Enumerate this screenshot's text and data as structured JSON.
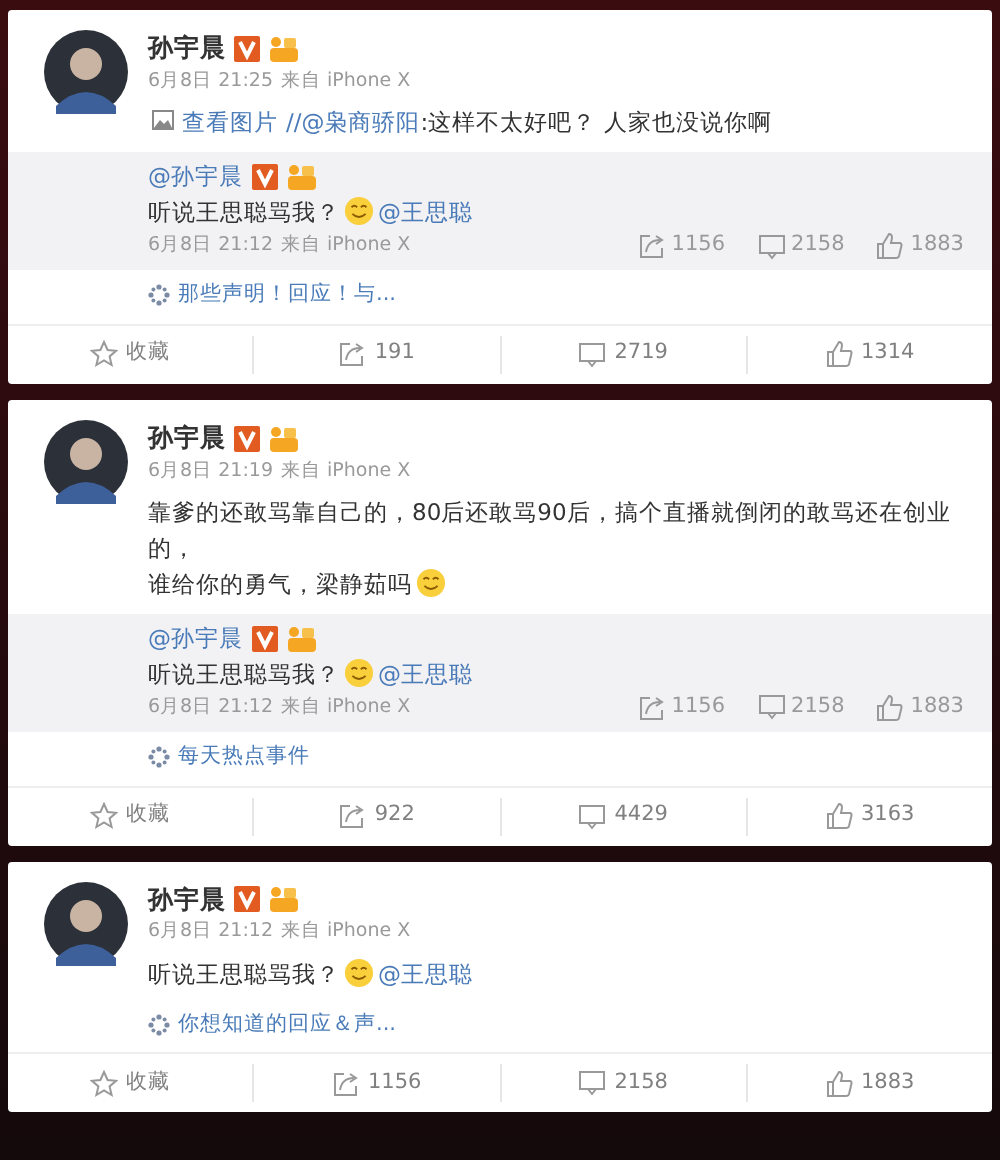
{
  "posts": [
    {
      "author": "孙宇晨",
      "time": "6月8日 21:25",
      "source": "来自 iPhone X",
      "body": [
        {
          "kind": "image-link",
          "text": "查看图片"
        },
        {
          "kind": "link",
          "text": "//@枭商骄阳"
        },
        {
          "kind": "text",
          "text": ":这样不太好吧？ 人家也没说你啊"
        }
      ],
      "quote": {
        "author": "@孙宇晨",
        "body": [
          {
            "kind": "text",
            "text": "听说王思聪骂我？"
          },
          {
            "kind": "emoji"
          },
          {
            "kind": "link",
            "text": "@王思聪"
          }
        ],
        "time": "6月8日 21:12",
        "source": "来自 iPhone X",
        "reposts": "1156",
        "comments": "2158",
        "likes": "1883"
      },
      "topic": "那些声明！回应！与...",
      "actions": {
        "favorite": "收藏",
        "reposts": "191",
        "comments": "2719",
        "likes": "1314"
      }
    },
    {
      "author": "孙宇晨",
      "time": "6月8日 21:19",
      "source": "来自 iPhone X",
      "body": [
        {
          "kind": "text",
          "text": "靠爹的还敢骂靠自己的，80后还敢骂90后，搞个直播就倒闭的敢骂还在创业的，"
        },
        {
          "kind": "text",
          "text": "谁给你的勇气，梁静茹吗"
        },
        {
          "kind": "emoji"
        }
      ],
      "quote": {
        "author": "@孙宇晨",
        "body": [
          {
            "kind": "text",
            "text": "听说王思聪骂我？"
          },
          {
            "kind": "emoji"
          },
          {
            "kind": "link",
            "text": "@王思聪"
          }
        ],
        "time": "6月8日 21:12",
        "source": "来自 iPhone X",
        "reposts": "1156",
        "comments": "2158",
        "likes": "1883"
      },
      "topic": "每天热点事件",
      "actions": {
        "favorite": "收藏",
        "reposts": "922",
        "comments": "4429",
        "likes": "3163"
      }
    },
    {
      "author": "孙宇晨",
      "time": "6月8日 21:12",
      "source": "来自 iPhone X",
      "body": [
        {
          "kind": "text",
          "text": "听说王思聪骂我？"
        },
        {
          "kind": "emoji"
        },
        {
          "kind": "link",
          "text": "@王思聪"
        }
      ],
      "topic": "你想知道的回应＆声...",
      "actions": {
        "favorite": "收藏",
        "reposts": "1156",
        "comments": "2158",
        "likes": "1883"
      }
    }
  ]
}
